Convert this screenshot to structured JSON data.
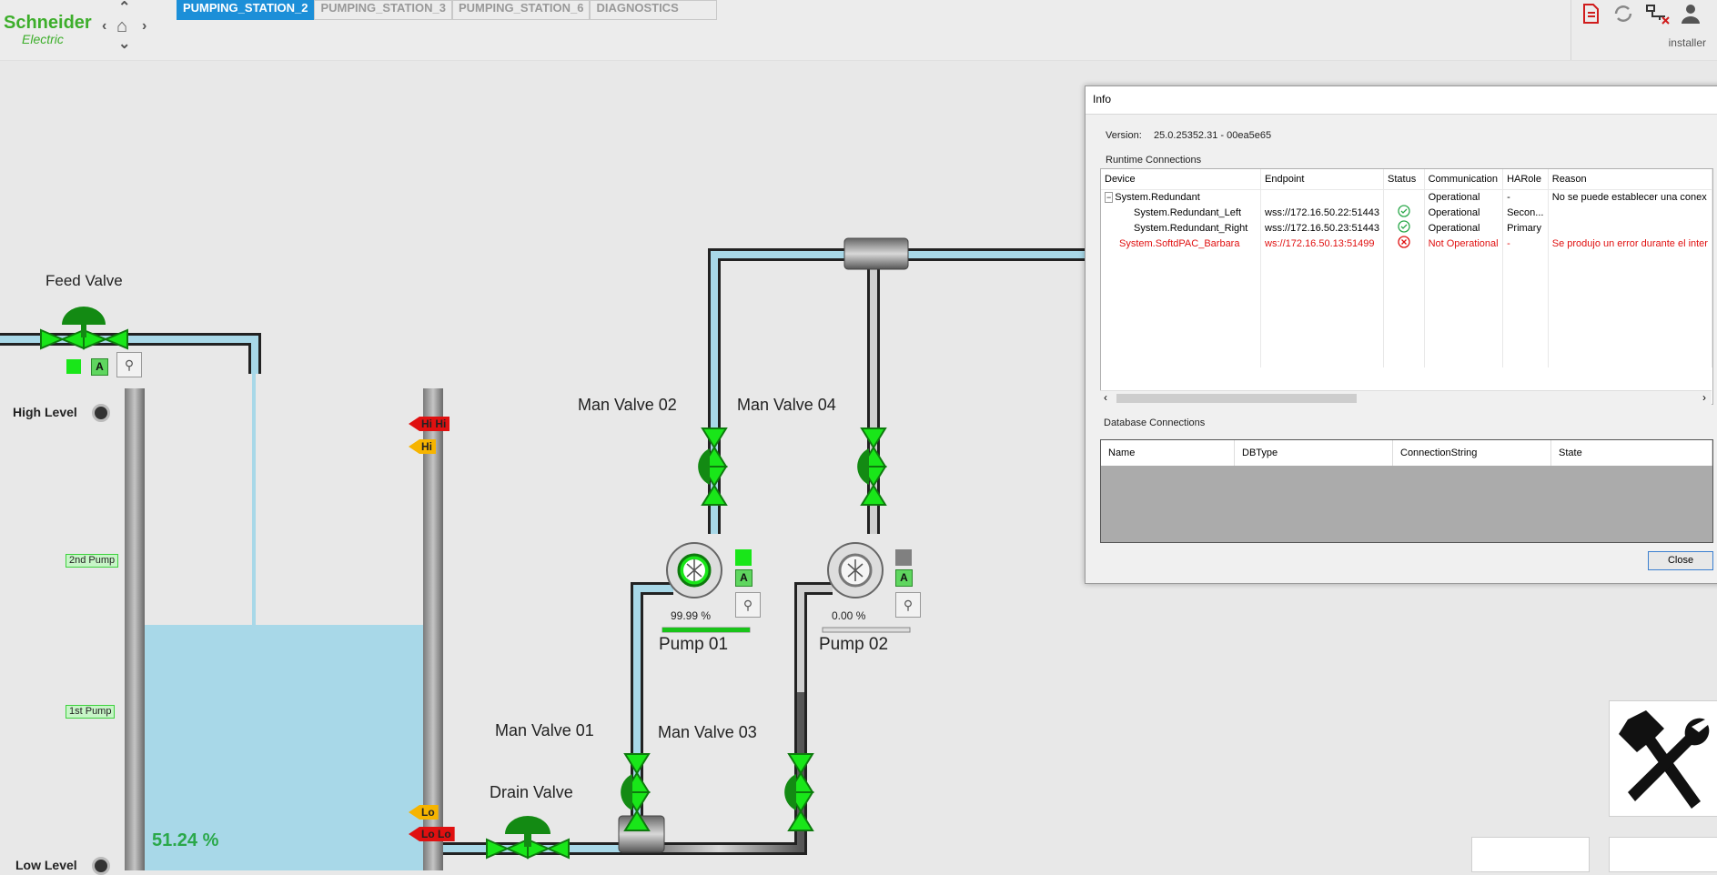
{
  "brand": {
    "line1": "Schneider",
    "line2": "Electric"
  },
  "nav": {
    "up": "⌃",
    "down": "⌄",
    "left": "‹",
    "right": "›",
    "home": "⌂"
  },
  "tabs": [
    "PUMPING_STATION_2",
    "PUMPING_STATION_3",
    "PUMPING_STATION_6",
    "DIAGNOSTICS"
  ],
  "user": "installer",
  "process": {
    "feed_valve": "Feed Valve",
    "high_level": "High Level",
    "low_level": "Low Level",
    "tank_level": "51.24 %",
    "tank_level_value": 51.24,
    "tag_2nd_pump": "2nd Pump",
    "tag_1st_pump": "1st Pump",
    "alarm_hihi": "Hi Hi",
    "alarm_hi": "Hi",
    "alarm_lo": "Lo",
    "alarm_lolo": "Lo Lo",
    "man_valve_01": "Man Valve 01",
    "man_valve_02": "Man Valve 02",
    "man_valve_03": "Man Valve 03",
    "man_valve_04": "Man Valve 04",
    "drain_valve": "Drain Valve",
    "pump01": {
      "name": "Pump 01",
      "speed": "99.99 %",
      "speed_value": 99.99
    },
    "pump02": {
      "name": "Pump 02",
      "speed": "0.00 %",
      "speed_value": 0.0
    },
    "auto": "A",
    "colors": {
      "running": "#19e619",
      "stopped": "#808080",
      "water": "#a8d8e8",
      "pipe": "#8c8c8c"
    }
  },
  "info": {
    "title": "Info",
    "version_label": "Version:",
    "version_value": "25.0.25352.31 - 00ea5e65",
    "runtime_label": "Runtime Connections",
    "columns": [
      "Device",
      "Endpoint",
      "Status",
      "Communication",
      "HARole",
      "Reason"
    ],
    "rows": [
      {
        "device": "System.Redundant",
        "endpoint": "",
        "status": "",
        "communication": "Operational",
        "harole": "-",
        "reason": "No se puede establecer una conex",
        "error": false
      },
      {
        "device": "System.Redundant_Left",
        "endpoint": "wss://172.16.50.22:51443",
        "status": "ok",
        "communication": "Operational",
        "harole": "Secon...",
        "reason": "",
        "error": false
      },
      {
        "device": "System.Redundant_Right",
        "endpoint": "wss://172.16.50.23:51443",
        "status": "ok",
        "communication": "Operational",
        "harole": "Primary",
        "reason": "",
        "error": false
      },
      {
        "device": "System.SoftdPAC_Barbara",
        "endpoint": "ws://172.16.50.13:51499",
        "status": "error",
        "communication": "Not Operational",
        "harole": "-",
        "reason": "Se produjo un error durante el inter",
        "error": true
      }
    ],
    "db_label": "Database Connections",
    "db_columns": [
      "Name",
      "DBType",
      "ConnectionString",
      "State"
    ],
    "close": "Close"
  }
}
